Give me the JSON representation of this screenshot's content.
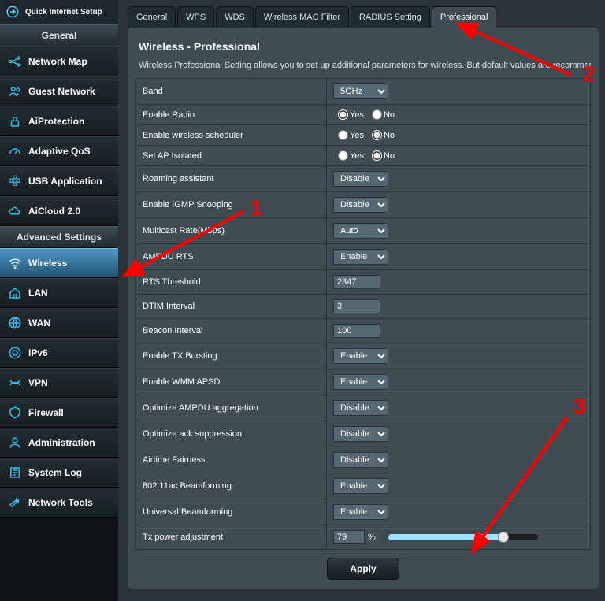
{
  "quick_setup": "Quick Internet Setup",
  "section_general": "General",
  "section_advanced": "Advanced Settings",
  "general_menu": [
    {
      "label": "Network Map"
    },
    {
      "label": "Guest Network"
    },
    {
      "label": "AiProtection"
    },
    {
      "label": "Adaptive QoS"
    },
    {
      "label": "USB Application"
    },
    {
      "label": "AiCloud 2.0"
    }
  ],
  "advanced_menu": [
    {
      "label": "Wireless"
    },
    {
      "label": "LAN"
    },
    {
      "label": "WAN"
    },
    {
      "label": "IPv6"
    },
    {
      "label": "VPN"
    },
    {
      "label": "Firewall"
    },
    {
      "label": "Administration"
    },
    {
      "label": "System Log"
    },
    {
      "label": "Network Tools"
    }
  ],
  "tabs": [
    "General",
    "WPS",
    "WDS",
    "Wireless MAC Filter",
    "RADIUS Setting",
    "Professional"
  ],
  "active_tab": 5,
  "panel_title": "Wireless - Professional",
  "panel_desc": "Wireless Professional Setting allows you to set up additional parameters for wireless. But default values are recommended.",
  "form": {
    "band": {
      "label": "Band",
      "value": "5GHz"
    },
    "enable_radio": {
      "label": "Enable Radio",
      "value": "Yes",
      "yes": "Yes",
      "no": "No"
    },
    "enable_sched": {
      "label": "Enable wireless scheduler",
      "value": "No",
      "yes": "Yes",
      "no": "No"
    },
    "set_ap": {
      "label": "Set AP Isolated",
      "value": "No",
      "yes": "Yes",
      "no": "No"
    },
    "roaming": {
      "label": "Roaming assistant",
      "value": "Disable"
    },
    "igmp": {
      "label": "Enable IGMP Snooping",
      "value": "Disable"
    },
    "mcast": {
      "label": "Multicast Rate(Mbps)",
      "value": "Auto"
    },
    "ampdu": {
      "label": "AMPDU RTS",
      "value": "Enable"
    },
    "rts": {
      "label": "RTS Threshold",
      "value": "2347"
    },
    "dtim": {
      "label": "DTIM Interval",
      "value": "3"
    },
    "beacon": {
      "label": "Beacon Interval",
      "value": "100"
    },
    "txburst": {
      "label": "Enable TX Bursting",
      "value": "Enable"
    },
    "wmm": {
      "label": "Enable WMM APSD",
      "value": "Enable"
    },
    "opt_ampdu": {
      "label": "Optimize AMPDU aggregation",
      "value": "Disable"
    },
    "opt_ack": {
      "label": "Optimize ack suppression",
      "value": "Disable"
    },
    "airtime": {
      "label": "Airtime Fairness",
      "value": "Disable"
    },
    "ac_bf": {
      "label": "802.11ac Beamforming",
      "value": "Enable"
    },
    "uni_bf": {
      "label": "Universal Beamforming",
      "value": "Enable"
    },
    "txpower": {
      "label": "Tx power adjustment",
      "value": "79",
      "pct": "%"
    }
  },
  "apply": "Apply",
  "anno": {
    "n1": "1",
    "n2": "2",
    "n3": "3"
  }
}
